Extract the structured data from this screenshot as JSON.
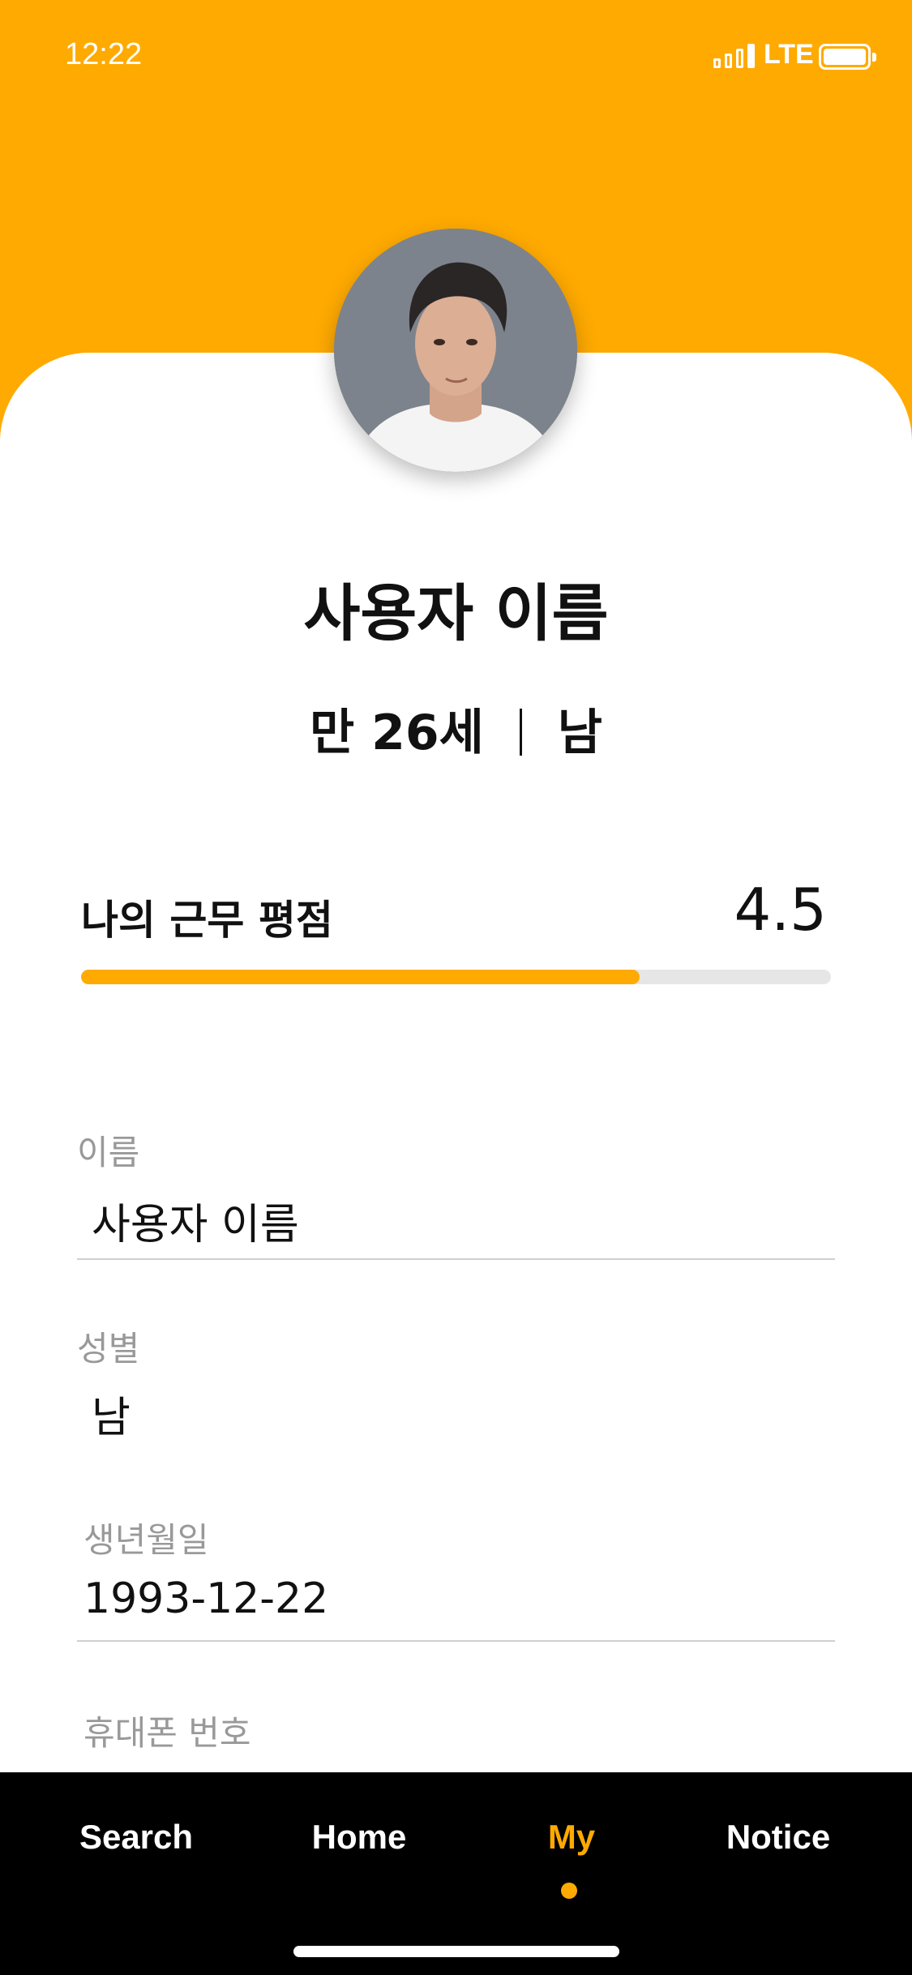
{
  "status_bar": {
    "time": "12:22",
    "network": "LTE"
  },
  "colors": {
    "accent": "#FFAA00",
    "nav_background": "#000000",
    "label_gray": "#999999"
  },
  "profile": {
    "name": "사용자 이름",
    "age": "만 26세",
    "gender": "남"
  },
  "rating": {
    "label": "나의 근무 평점",
    "value": "4.5",
    "fill_fraction": 0.745
  },
  "fields": [
    {
      "label": "이름",
      "value": "사용자 이름"
    },
    {
      "label": "성별",
      "value": "남"
    },
    {
      "label": "생년월일",
      "value": "1993-12-22"
    },
    {
      "label": "휴대폰 번호",
      "value": ""
    }
  ],
  "nav": {
    "items": [
      {
        "label": "Search"
      },
      {
        "label": "Home"
      },
      {
        "label": "My"
      },
      {
        "label": "Notice"
      }
    ],
    "active_index": 2
  }
}
